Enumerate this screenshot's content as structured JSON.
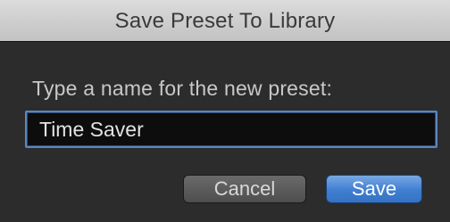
{
  "dialog": {
    "title": "Save Preset To Library",
    "prompt": "Type a name for the new preset:",
    "name_field": {
      "value": "Time Saver"
    },
    "buttons": {
      "cancel_label": "Cancel",
      "save_label": "Save"
    },
    "colors": {
      "accent": "#3f7ed0",
      "title_bar": "#cdcdcd",
      "panel": "#2c2c2c"
    }
  }
}
